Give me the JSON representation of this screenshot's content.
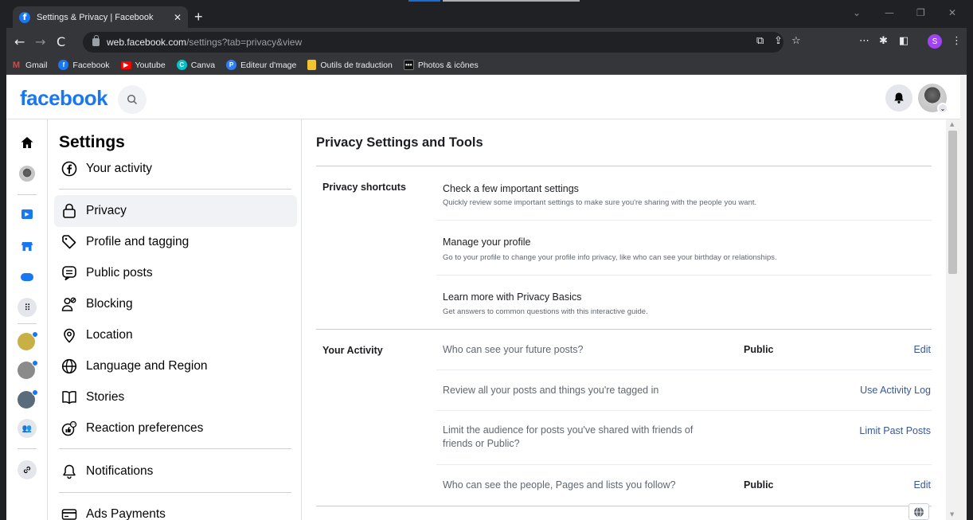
{
  "browser": {
    "tab_title": "Settings & Privacy | Facebook",
    "url_host": "web.facebook.com",
    "url_path": "/settings?tab=privacy&view",
    "profile_initial": "S",
    "bookmarks": [
      {
        "label": "Gmail",
        "color": "#ea4335",
        "glyph": "M"
      },
      {
        "label": "Facebook",
        "color": "#1877f2",
        "glyph": "f"
      },
      {
        "label": "Youtube",
        "color": "#ff0000",
        "glyph": "▶"
      },
      {
        "label": "Canva",
        "color": "#00c4cc",
        "glyph": "C"
      },
      {
        "label": "Editeur d'mage",
        "color": "#2d7ff9",
        "glyph": "P"
      },
      {
        "label": "Outils de traduction",
        "color": "#f4c430",
        "glyph": ""
      },
      {
        "label": "Photos & icônes",
        "color": "#111111",
        "glyph": "•••"
      }
    ]
  },
  "header": {
    "logo": "facebook"
  },
  "settings": {
    "title": "Settings",
    "items": [
      {
        "label": "Your activity",
        "icon": "facebook-circle-icon"
      },
      {
        "label": "Privacy",
        "icon": "lock-icon"
      },
      {
        "label": "Profile and tagging",
        "icon": "tag-icon"
      },
      {
        "label": "Public posts",
        "icon": "public-posts-icon"
      },
      {
        "label": "Blocking",
        "icon": "blocking-icon"
      },
      {
        "label": "Location",
        "icon": "location-icon"
      },
      {
        "label": "Language and Region",
        "icon": "globe-icon"
      },
      {
        "label": "Stories",
        "icon": "book-icon"
      },
      {
        "label": "Reaction preferences",
        "icon": "reaction-icon"
      },
      {
        "label": "Notifications",
        "icon": "bell-icon"
      },
      {
        "label": "Ads Payments",
        "icon": "card-icon"
      }
    ]
  },
  "main": {
    "title": "Privacy Settings and Tools",
    "shortcuts": {
      "label": "Privacy shortcuts",
      "rows": [
        {
          "title": "Check a few important settings",
          "sub": "Quickly review some important settings to make sure you're sharing with the people you want."
        },
        {
          "title": "Manage your profile",
          "sub": "Go to your profile to change your profile info privacy, like who can see your birthday or relationships."
        },
        {
          "title": "Learn more with Privacy Basics",
          "sub": "Get answers to common questions with this interactive guide."
        }
      ]
    },
    "activity": {
      "label": "Your Activity",
      "rows": [
        {
          "title": "Who can see your future posts?",
          "value": "Public",
          "link": "Edit"
        },
        {
          "title": "Review all your posts and things you're tagged in",
          "value": "",
          "link": "Use Activity Log"
        },
        {
          "title": "Limit the audience for posts you've shared with friends of friends or Public?",
          "value": "",
          "link": "Limit Past Posts"
        },
        {
          "title": "Who can see the people, Pages and lists you follow?",
          "value": "Public",
          "link": "Edit"
        }
      ]
    }
  }
}
